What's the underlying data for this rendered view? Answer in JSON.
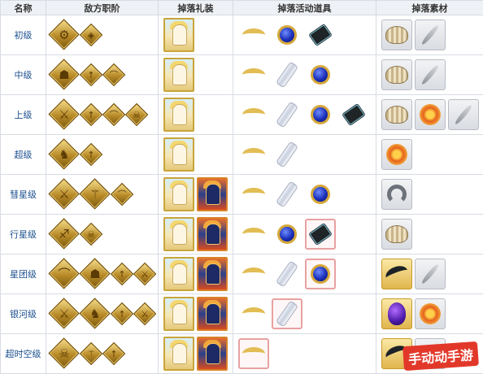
{
  "headers": [
    "名称",
    "敌方职阶",
    "掉落礼装",
    "掉落活动道具",
    "掉落素材"
  ],
  "rows": [
    {
      "level": "初级",
      "classes": [
        {
          "icon": "saber-class-icon",
          "glyph": "⚙",
          "big": true
        },
        {
          "icon": "rider-class-icon",
          "glyph": "◈",
          "big": false
        }
      ],
      "essences": [
        "white-haired-girl-essence"
      ],
      "items": [
        {
          "icon": "golden-horn-icon",
          "kind": "horn",
          "hl": false
        },
        {
          "icon": "blue-gem-icon",
          "kind": "gem",
          "hl": false
        },
        {
          "icon": "black-chip-icon",
          "kind": "chip",
          "hl": false
        }
      ],
      "materials": [
        {
          "icon": "shell-icon",
          "kind": "shell",
          "gold": false
        },
        {
          "icon": "feather-icon",
          "kind": "feather",
          "gold": false
        }
      ]
    },
    {
      "level": "中级",
      "classes": [
        {
          "icon": "caster-class-icon",
          "glyph": "☗",
          "big": true
        },
        {
          "icon": "lancer-class-icon",
          "glyph": "↑",
          "big": false
        },
        {
          "icon": "archer-class-icon",
          "glyph": "⌒",
          "big": false
        }
      ],
      "essences": [
        "white-haired-girl-essence"
      ],
      "items": [
        {
          "icon": "golden-horn-icon",
          "kind": "horn",
          "hl": false
        },
        {
          "icon": "glass-vial-icon",
          "kind": "vial",
          "hl": false
        },
        {
          "icon": "blue-gem-icon",
          "kind": "gem",
          "hl": false
        }
      ],
      "materials": [
        {
          "icon": "shell-icon",
          "kind": "shell",
          "gold": false
        },
        {
          "icon": "feather-icon",
          "kind": "feather",
          "gold": false
        }
      ]
    },
    {
      "level": "上级",
      "classes": [
        {
          "icon": "assassin-class-icon",
          "glyph": "⚔",
          "big": true
        },
        {
          "icon": "lancer-class-icon",
          "glyph": "↑",
          "big": false
        },
        {
          "icon": "archer-class-icon",
          "glyph": "⌒",
          "big": false
        },
        {
          "icon": "berserker-class-icon",
          "glyph": "☠",
          "big": false
        }
      ],
      "essences": [
        "white-haired-girl-essence"
      ],
      "items": [
        {
          "icon": "golden-horn-icon",
          "kind": "horn",
          "hl": false
        },
        {
          "icon": "glass-vial-icon",
          "kind": "vial",
          "hl": false
        },
        {
          "icon": "blue-gem-icon",
          "kind": "gem",
          "hl": false
        },
        {
          "icon": "black-chip-icon",
          "kind": "chip",
          "hl": false
        }
      ],
      "materials": [
        {
          "icon": "shell-icon",
          "kind": "shell",
          "gold": false
        },
        {
          "icon": "flower-icon",
          "kind": "flower",
          "gold": false
        },
        {
          "icon": "feather-icon",
          "kind": "feather",
          "gold": false
        }
      ]
    },
    {
      "level": "超级",
      "classes": [
        {
          "icon": "rider-class-icon",
          "glyph": "♞",
          "big": true
        },
        {
          "icon": "lancer-class-icon",
          "glyph": "↑",
          "big": false
        }
      ],
      "essences": [
        "white-haired-girl-essence"
      ],
      "items": [
        {
          "icon": "golden-horn-icon",
          "kind": "horn",
          "hl": false
        },
        {
          "icon": "glass-vial-icon",
          "kind": "vial",
          "hl": false
        }
      ],
      "materials": [
        {
          "icon": "flower-icon",
          "kind": "flower",
          "gold": false
        }
      ]
    },
    {
      "level": "彗星级",
      "classes": [
        {
          "icon": "assassin-class-icon",
          "glyph": "⚔",
          "big": true
        },
        {
          "icon": "caster-class-icon",
          "glyph": "⚚",
          "big": true
        },
        {
          "icon": "archer-class-icon",
          "glyph": "⌒",
          "big": false
        }
      ],
      "essences": [
        "white-haired-girl-essence",
        "dark-knight-essence"
      ],
      "items": [
        {
          "icon": "golden-horn-icon",
          "kind": "horn",
          "hl": false
        },
        {
          "icon": "glass-vial-icon",
          "kind": "vial",
          "hl": false
        },
        {
          "icon": "blue-gem-icon",
          "kind": "gem",
          "hl": false
        }
      ],
      "materials": [
        {
          "icon": "horseshoe-icon",
          "kind": "shoe",
          "gold": false
        }
      ]
    },
    {
      "level": "行星级",
      "classes": [
        {
          "icon": "archer-class-icon",
          "glyph": "♐",
          "big": true
        },
        {
          "icon": "berserker-class-icon",
          "glyph": "☠",
          "big": false
        }
      ],
      "essences": [
        "white-haired-girl-essence",
        "dark-knight-essence"
      ],
      "items": [
        {
          "icon": "golden-horn-icon",
          "kind": "horn",
          "hl": false
        },
        {
          "icon": "blue-gem-icon",
          "kind": "gem",
          "hl": false
        },
        {
          "icon": "black-chip-icon",
          "kind": "chip",
          "hl": true
        }
      ],
      "materials": [
        {
          "icon": "shell-icon",
          "kind": "shell",
          "gold": false
        }
      ]
    },
    {
      "level": "星团级",
      "classes": [
        {
          "icon": "archer-class-icon",
          "glyph": "⌒",
          "big": true
        },
        {
          "icon": "caster-class-icon",
          "glyph": "☗",
          "big": true
        },
        {
          "icon": "lancer-class-icon",
          "glyph": "↑",
          "big": false
        },
        {
          "icon": "assassin-class-icon",
          "glyph": "⚔",
          "big": false
        }
      ],
      "essences": [
        "white-haired-girl-essence",
        "dark-knight-essence"
      ],
      "items": [
        {
          "icon": "golden-horn-icon",
          "kind": "horn",
          "hl": false
        },
        {
          "icon": "glass-vial-icon",
          "kind": "vial",
          "hl": false
        },
        {
          "icon": "blue-gem-icon",
          "kind": "gem",
          "hl": true
        }
      ],
      "materials": [
        {
          "icon": "black-fang-icon",
          "kind": "fang",
          "gold": true
        },
        {
          "icon": "feather-icon",
          "kind": "feather",
          "gold": false
        }
      ]
    },
    {
      "level": "银河级",
      "classes": [
        {
          "icon": "assassin-class-icon",
          "glyph": "⚔",
          "big": true
        },
        {
          "icon": "rider-class-icon",
          "glyph": "♞",
          "big": true
        },
        {
          "icon": "lancer-class-icon",
          "glyph": "↑",
          "big": false
        },
        {
          "icon": "assassin-class-icon",
          "glyph": "⚔",
          "big": false
        }
      ],
      "essences": [
        "white-haired-girl-essence",
        "dark-knight-essence"
      ],
      "items": [
        {
          "icon": "golden-horn-icon",
          "kind": "horn",
          "hl": false
        },
        {
          "icon": "glass-vial-icon",
          "kind": "vial",
          "hl": true
        }
      ],
      "materials": [
        {
          "icon": "purple-egg-icon",
          "kind": "egg",
          "gold": true
        },
        {
          "icon": "flower-icon",
          "kind": "flower",
          "gold": false
        }
      ]
    },
    {
      "level": "超时空级",
      "classes": [
        {
          "icon": "berserker-class-icon",
          "glyph": "☠",
          "big": true
        },
        {
          "icon": "caster-class-icon",
          "glyph": "⚚",
          "big": false
        },
        {
          "icon": "lancer-class-icon",
          "glyph": "↑",
          "big": false
        }
      ],
      "essences": [
        "white-haired-girl-essence",
        "dark-knight-essence"
      ],
      "items": [
        {
          "icon": "golden-horn-icon",
          "kind": "horn",
          "hl": true
        }
      ],
      "materials": [
        {
          "icon": "black-fang-icon",
          "kind": "fang",
          "gold": true
        },
        {
          "icon": "sword-icon",
          "kind": "sword",
          "gold": false
        }
      ]
    }
  ],
  "watermark": "手动动手游"
}
